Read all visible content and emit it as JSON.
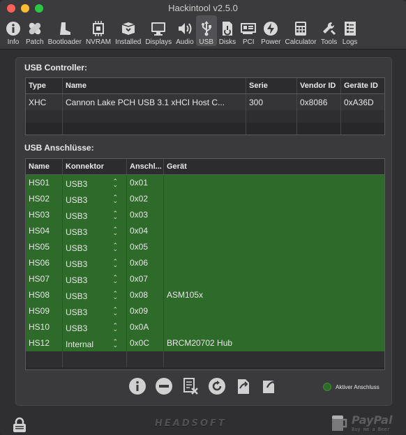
{
  "window": {
    "title": "Hackintool v2.5.0"
  },
  "toolbar": {
    "items": [
      {
        "label": "Info",
        "icon": "info-icon"
      },
      {
        "label": "Patch",
        "icon": "bandage-icon"
      },
      {
        "label": "Bootloader",
        "icon": "boot-icon"
      },
      {
        "label": "NVRAM",
        "icon": "chip-icon"
      },
      {
        "label": "Installed",
        "icon": "box-icon"
      },
      {
        "label": "Displays",
        "icon": "display-icon"
      },
      {
        "label": "Audio",
        "icon": "speaker-icon"
      },
      {
        "label": "USB",
        "icon": "usb-icon",
        "active": true
      },
      {
        "label": "Disks",
        "icon": "disk-icon"
      },
      {
        "label": "PCI",
        "icon": "pci-card-icon"
      },
      {
        "label": "Power",
        "icon": "power-icon"
      },
      {
        "label": "Calculator",
        "icon": "calculator-icon"
      },
      {
        "label": "Tools",
        "icon": "wrench-icon"
      },
      {
        "label": "Logs",
        "icon": "log-icon"
      }
    ]
  },
  "controllers": {
    "title": "USB Controller:",
    "headers": [
      "Type",
      "Name",
      "Serie",
      "Vendor ID",
      "Geräte ID"
    ],
    "rows": [
      [
        "XHC",
        "Cannon Lake PCH USB 3.1 xHCI Host C...",
        "300",
        "0x8086",
        "0xA36D"
      ]
    ]
  },
  "ports": {
    "title": "USB Anschlüsse:",
    "headers": [
      "Name",
      "Konnektor",
      "Anschl...",
      "Gerät"
    ],
    "rows": [
      [
        "HS01",
        "USB3",
        "0x01",
        ""
      ],
      [
        "HS02",
        "USB3",
        "0x02",
        ""
      ],
      [
        "HS03",
        "USB3",
        "0x03",
        ""
      ],
      [
        "HS04",
        "USB3",
        "0x04",
        ""
      ],
      [
        "HS05",
        "USB3",
        "0x05",
        ""
      ],
      [
        "HS06",
        "USB3",
        "0x06",
        ""
      ],
      [
        "HS07",
        "USB3",
        "0x07",
        ""
      ],
      [
        "HS08",
        "USB3",
        "0x08",
        "ASM105x"
      ],
      [
        "HS09",
        "USB3",
        "0x09",
        ""
      ],
      [
        "HS10",
        "USB3",
        "0x0A",
        ""
      ],
      [
        "HS12",
        "Internal",
        "0x0C",
        "BRCM20702 Hub"
      ]
    ],
    "active_color": "#2e6a2a"
  },
  "actions": [
    "info-icon",
    "remove-icon",
    "clear-icon",
    "refresh-icon",
    "import-icon",
    "export-icon"
  ],
  "legend": {
    "label": "Aktiver Anschluss"
  },
  "footer": {
    "brand": "HEADSOFT",
    "paypal": "PayPal",
    "paypal_sub": "Buy me a Beer"
  }
}
